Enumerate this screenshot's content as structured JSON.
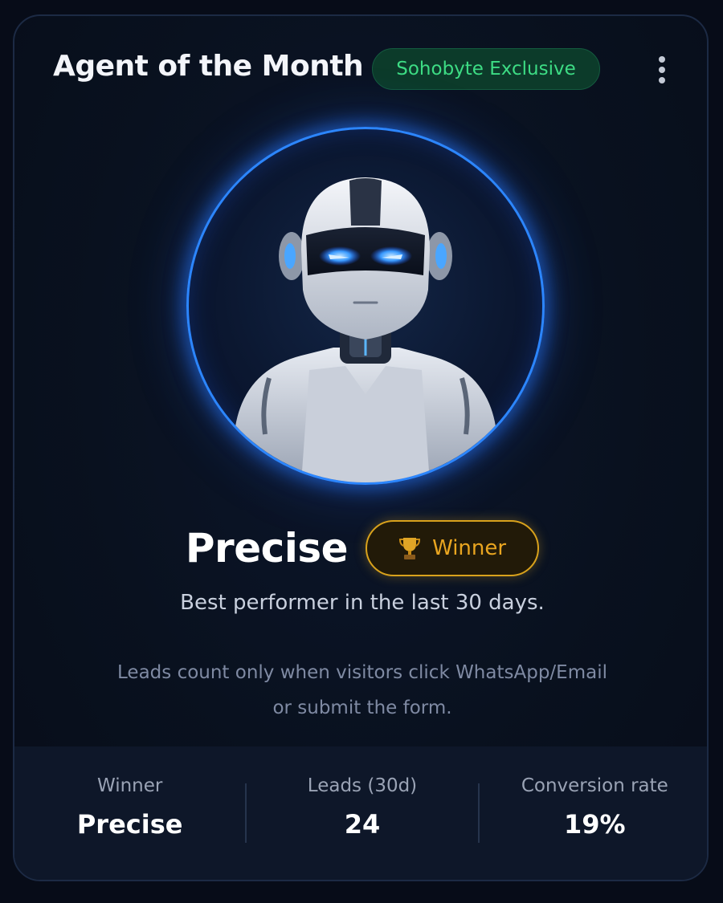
{
  "header": {
    "title": "Agent of the Month",
    "exclusive_badge": "Sohobyte Exclusive"
  },
  "agent": {
    "name": "Precise",
    "badge_label": "Winner",
    "subtitle": "Best performer in the last 30 days.",
    "note_line1": "Leads count only when visitors click WhatsApp/Email",
    "note_line2": "or submit the form."
  },
  "stats": [
    {
      "label": "Winner",
      "value": "Precise"
    },
    {
      "label": "Leads (30d)",
      "value": "24"
    },
    {
      "label": "Conversion rate",
      "value": "19%"
    }
  ],
  "colors": {
    "accent_green": "#3ddc84",
    "accent_gold": "#e9a520",
    "avatar_ring": "#2c86ff"
  }
}
